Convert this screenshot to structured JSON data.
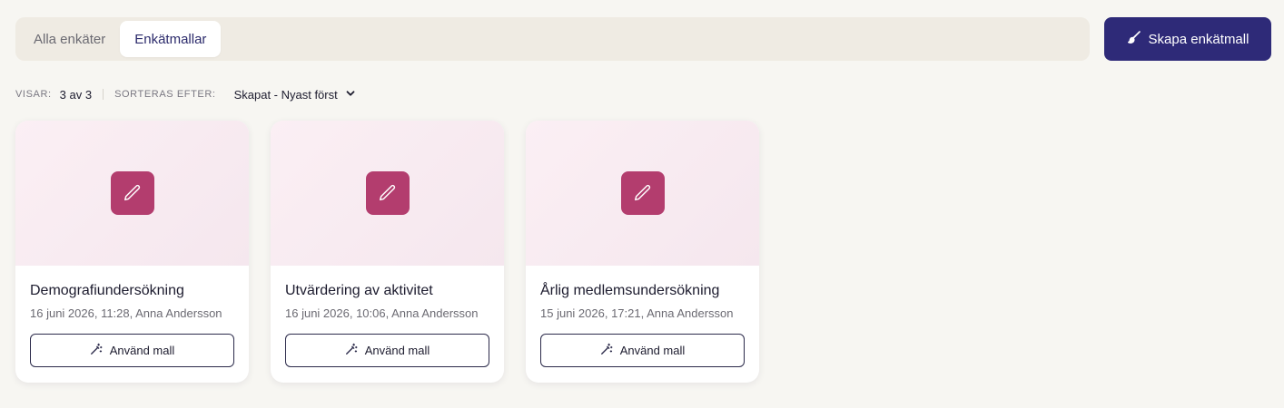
{
  "tabs": [
    {
      "label": "Alla enkäter",
      "active": false
    },
    {
      "label": "Enkätmallar",
      "active": true
    }
  ],
  "create_button": {
    "label": "Skapa enkätmall",
    "icon": "brush-icon"
  },
  "meta": {
    "showing_label": "Visar:",
    "showing_value": "3 av 3",
    "sort_label": "Sorteras efter:",
    "sort_value": "Skapat - Nyast först"
  },
  "cards": [
    {
      "title": "Demografiundersökning",
      "subtitle": "16 juni 2026, 11:28, Anna Andersson",
      "button_label": "Använd mall"
    },
    {
      "title": "Utvärdering av aktivitet",
      "subtitle": "16 juni 2026, 10:06, Anna Andersson",
      "button_label": "Använd mall"
    },
    {
      "title": "Årlig medlemsundersökning",
      "subtitle": "15 juni 2026, 17:21, Anna Andersson",
      "button_label": "Använd mall"
    }
  ],
  "colors": {
    "accent": "#2e2a78",
    "card_icon_bg": "#b33d6e",
    "background": "#f7f6f2"
  }
}
